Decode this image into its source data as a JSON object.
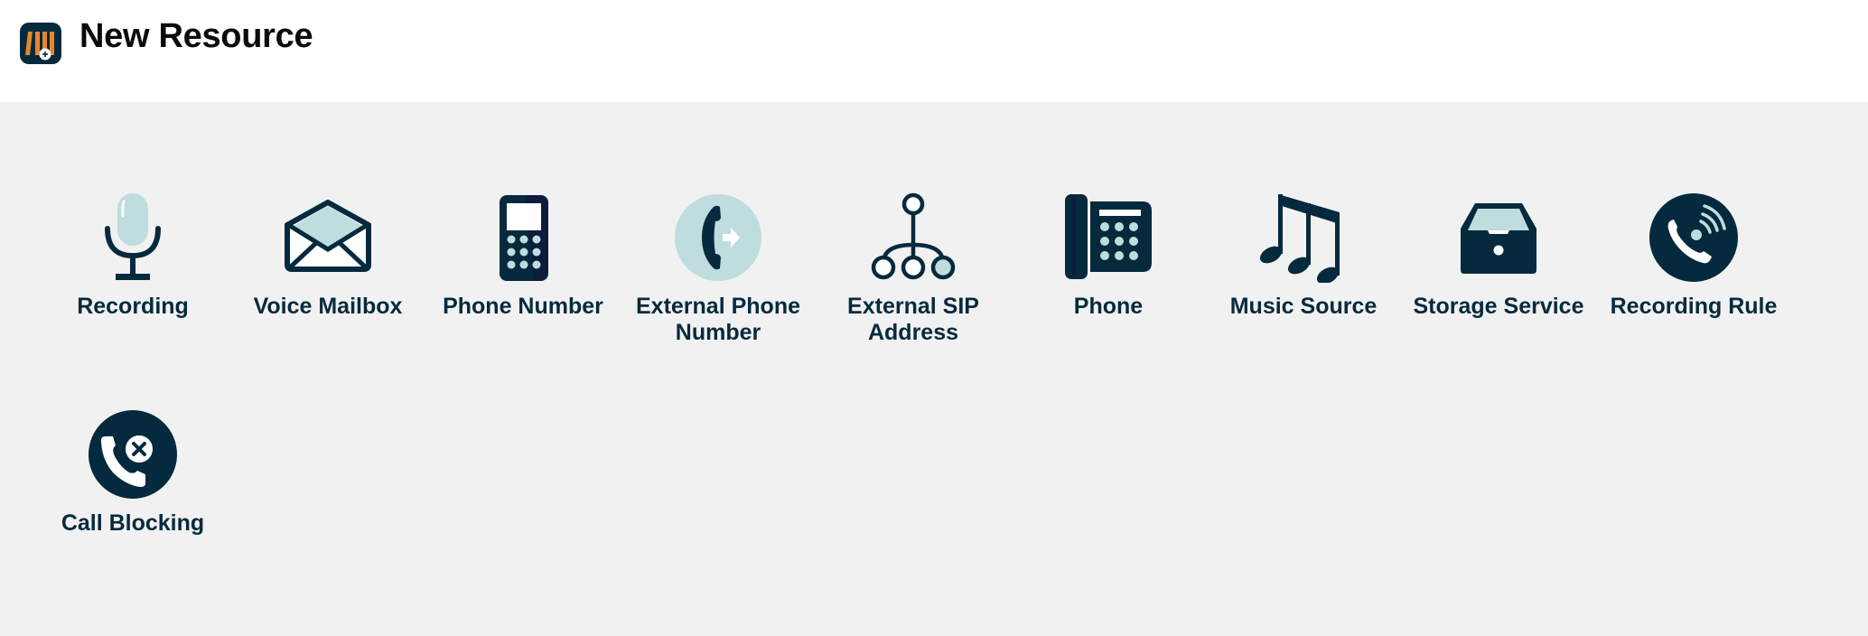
{
  "header": {
    "title": "New Resource",
    "logo_icon": "resource-library-add-icon"
  },
  "colors": {
    "primary_dark": "#062a3d",
    "accent_light": "#bfdcde",
    "logo_orange": "#e8862a",
    "background": "#f1f1f1",
    "header_background": "#ffffff"
  },
  "resources": [
    {
      "label": "Recording",
      "icon": "microphone-icon"
    },
    {
      "label": "Voice Mailbox",
      "icon": "envelope-open-icon"
    },
    {
      "label": "Phone Number",
      "icon": "mobile-phone-icon"
    },
    {
      "label": "External Phone Number",
      "icon": "phone-forward-icon"
    },
    {
      "label": "External SIP Address",
      "icon": "sip-tree-icon"
    },
    {
      "label": "Phone",
      "icon": "desk-phone-icon"
    },
    {
      "label": "Music Source",
      "icon": "music-notes-icon"
    },
    {
      "label": "Storage Service",
      "icon": "storage-drawer-icon"
    },
    {
      "label": "Recording Rule",
      "icon": "phone-recording-icon"
    },
    {
      "label": "Call Blocking",
      "icon": "call-blocking-icon"
    }
  ]
}
